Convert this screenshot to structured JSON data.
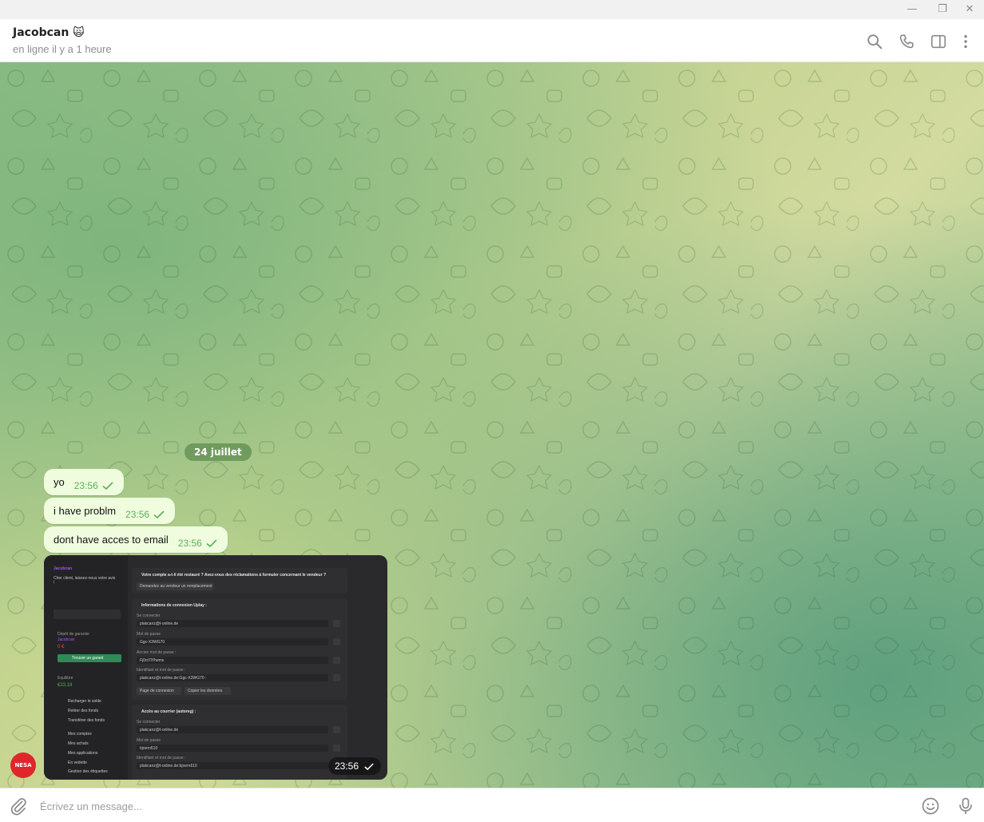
{
  "window": {
    "minimize_icon": "minimize-icon",
    "restore_icon": "restore-icon",
    "close_icon": "close-icon"
  },
  "header": {
    "name": "Jacobcan 🙀",
    "status": "en ligne il y a 1 heure",
    "icons": [
      "search-icon",
      "phone-icon",
      "sidebar-toggle-icon",
      "more-vertical-icon"
    ]
  },
  "chat": {
    "date_label": "24 juillet",
    "messages": [
      {
        "text": "yo",
        "time": "23:56"
      },
      {
        "text": "i have problm",
        "time": "23:56"
      },
      {
        "text": "dont have acces to email",
        "time": "23:56"
      }
    ],
    "image_message": {
      "time": "23:56",
      "screenshot": {
        "seller_name": "Jacobcan",
        "greeting": "Cher client, laissez-nous votre avis !",
        "escrow_label": "Dépôt de garantie",
        "escrow_user": "Jacobcan",
        "escrow_amount": "0 €",
        "find_guarantor": "Trouver un garant",
        "balance_label": "Equilibre",
        "balance": "€23,19",
        "menu": [
          "Recharger le solde",
          "Retirer des fonds",
          "Transférer des fonds",
          "Mes comptes",
          "Mes achats",
          "Mes applications",
          "En vedette",
          "Gestion des étiquettes"
        ],
        "restored_question": "Votre compte a-t-il été restauré ? Avez-vous des réclamations à formuler concernant le vendeur ?",
        "ask_replacement": "Demandez au vendeur un remplacement",
        "login_section": "Informations de connexion Uplay :",
        "login_label": "Se connecter",
        "login_value": "plakcanz@t-online.de",
        "password_label": "Mot de passe",
        "password_value": "Ggc-X3WG70",
        "old_password_label": "Ancien mot de passe :",
        "old_password_value": "Fj0ct7lYhems",
        "id_label": "Identifiant et mot de passe :",
        "id_value": "plakcanz@t-online.de:Ggc-X3WG70 :",
        "login_page_btn": "Page de connexion",
        "copy_data_btn": "Copier les données",
        "mail_section": "Accès au courrier (autoreg) :",
        "mail_login_value": "plakcanz@t-online.de",
        "mail_password_value": "bjoern610",
        "mail_id_value": "plakcanz@t-online.de:bjoern610"
      }
    },
    "avatar_label": "NESA"
  },
  "composer": {
    "placeholder": "Écrivez un message...",
    "attach_icon": "paperclip-icon",
    "emoji_icon": "emoji-icon",
    "mic_icon": "microphone-icon"
  }
}
